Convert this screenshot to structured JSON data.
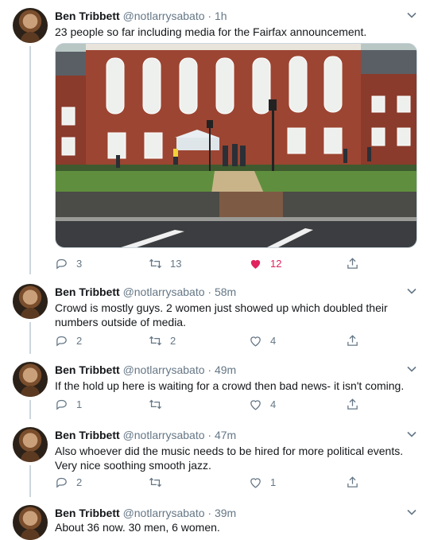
{
  "tweets": [
    {
      "name": "Ben Tribbett",
      "handle": "@notlarrysabato",
      "time": "1h",
      "text": "23 people so far including media for the Fairfax announcement.",
      "reply_count": "3",
      "retweet_count": "13",
      "like_count": "12",
      "liked": true
    },
    {
      "name": "Ben Tribbett",
      "handle": "@notlarrysabato",
      "time": "58m",
      "text": "Crowd is mostly guys.  2 women just showed up which doubled their numbers outside of media.",
      "reply_count": "2",
      "retweet_count": "2",
      "like_count": "4"
    },
    {
      "name": "Ben Tribbett",
      "handle": "@notlarrysabato",
      "time": "49m",
      "text": "If the hold up here is waiting for a crowd then bad news- it isn't coming.",
      "reply_count": "1",
      "retweet_count": "",
      "like_count": "4"
    },
    {
      "name": "Ben Tribbett",
      "handle": "@notlarrysabato",
      "time": "47m",
      "text": "Also whoever did the music needs to be hired for more political events.  Very nice soothing smooth jazz.",
      "reply_count": "2",
      "retweet_count": "",
      "like_count": "1"
    },
    {
      "name": "Ben Tribbett",
      "handle": "@notlarrysabato",
      "time": "39m",
      "text": "About 36 now.  30 men, 6 women."
    }
  ],
  "sep": " · ",
  "colors": {
    "like": "#e0245e",
    "muted": "#657786",
    "line": "#ccd6dd"
  }
}
